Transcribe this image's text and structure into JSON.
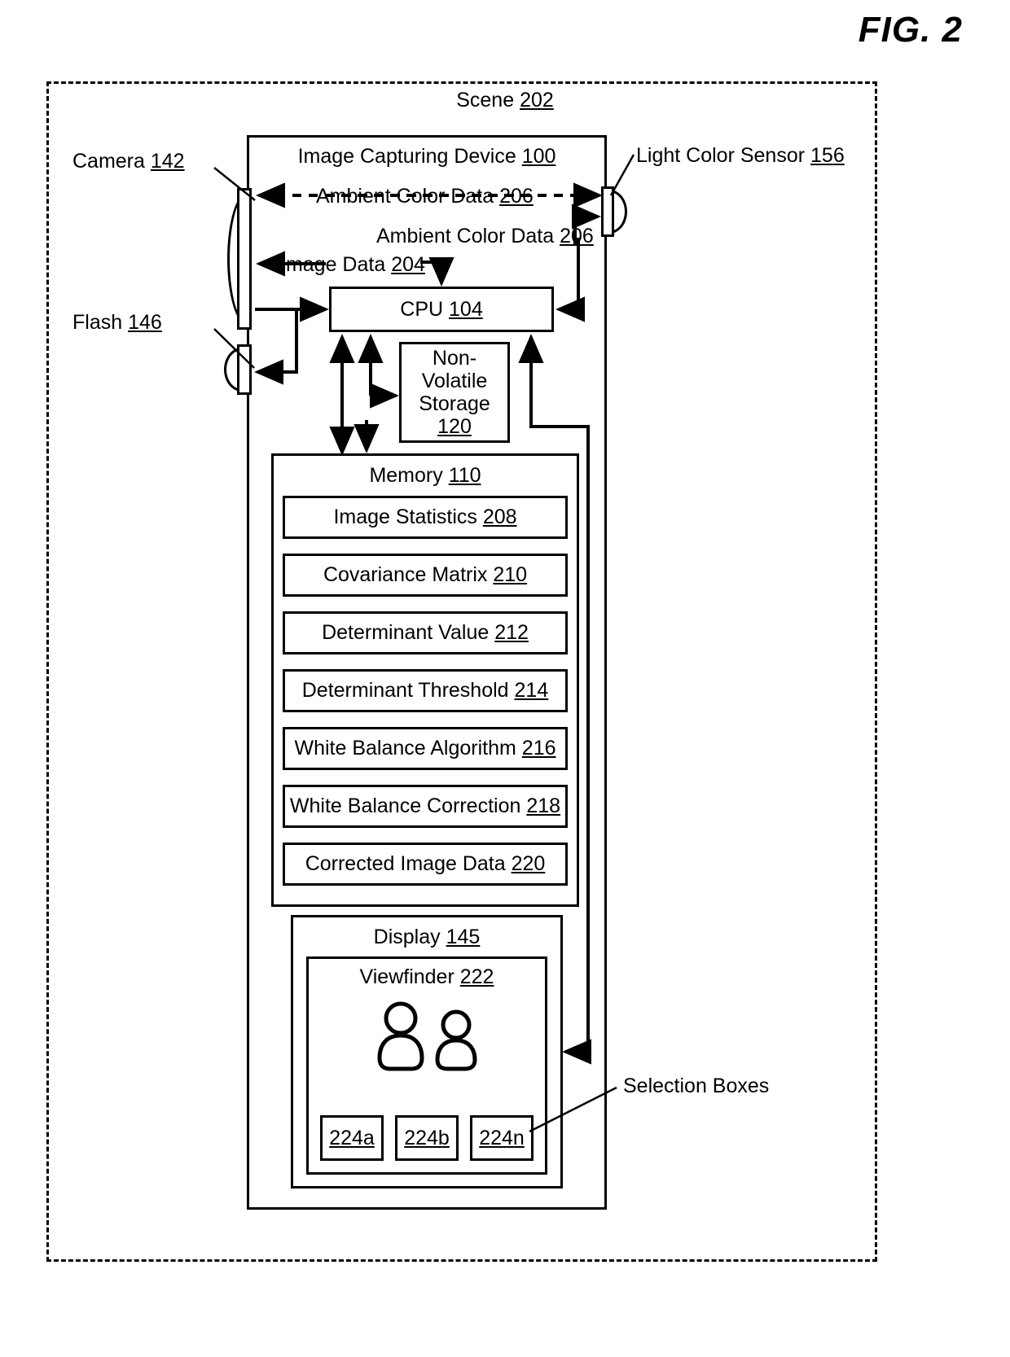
{
  "figure": {
    "title": "FIG. 2"
  },
  "scene": {
    "label_text": "Scene",
    "label_ref": "202"
  },
  "device": {
    "label_text": "Image Capturing Device",
    "label_ref": "100"
  },
  "callouts": {
    "camera": {
      "text": "Camera",
      "ref": "142",
      "icon": "camera-lens-icon"
    },
    "flash": {
      "text": "Flash",
      "ref": "146",
      "icon": "flash-lens-icon"
    },
    "light_color_sensor": {
      "text": "Light Color Sensor",
      "ref": "156",
      "icon": "light-sensor-icon"
    },
    "selection_boxes": {
      "text": "Selection Boxes",
      "ref": ""
    }
  },
  "flows": {
    "ambient_color_data_top": {
      "text": "Ambient Color Data",
      "ref": "206"
    },
    "ambient_color_data_mid": {
      "text": "Ambient Color Data",
      "ref": "206"
    },
    "image_data": {
      "text": "Image Data",
      "ref": "204"
    }
  },
  "cpu": {
    "label_text": "CPU",
    "label_ref": "104"
  },
  "non_volatile_storage": {
    "line1": "Non-",
    "line2": "Volatile",
    "line3": "Storage",
    "label_ref": "120"
  },
  "memory": {
    "label_text": "Memory",
    "label_ref": "110",
    "items": [
      {
        "text": "Image Statistics",
        "ref": "208"
      },
      {
        "text": "Covariance Matrix",
        "ref": "210"
      },
      {
        "text": "Determinant Value",
        "ref": "212"
      },
      {
        "text": "Determinant Threshold",
        "ref": "214"
      },
      {
        "text": "White Balance Algorithm",
        "ref": "216"
      },
      {
        "text": "White Balance Correction",
        "ref": "218"
      },
      {
        "text": "Corrected Image Data",
        "ref": "220"
      }
    ]
  },
  "display": {
    "label_text": "Display",
    "label_ref": "145",
    "viewfinder": {
      "label_text": "Viewfinder",
      "label_ref": "222",
      "subjects": [
        {
          "name": "person-silhouette-icon-left"
        },
        {
          "name": "person-silhouette-icon-right"
        }
      ],
      "selection_boxes": [
        {
          "ref": "224a"
        },
        {
          "ref": "224b"
        },
        {
          "ref": "224n"
        }
      ]
    }
  },
  "colors": {
    "ink": "#000000",
    "paper": "#ffffff"
  }
}
